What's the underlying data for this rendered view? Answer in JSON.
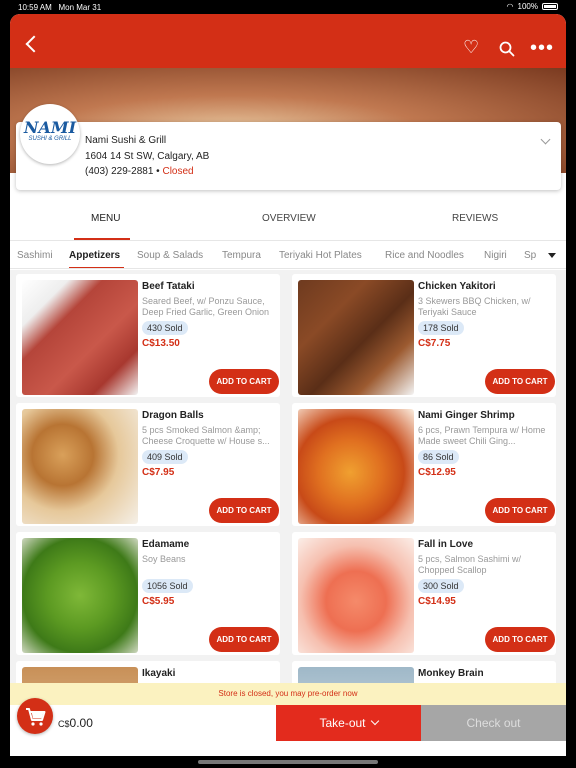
{
  "status_bar": {
    "time": "10:59 AM",
    "date": "Mon Mar 31",
    "battery": "100%"
  },
  "header": {
    "icons": [
      "back-icon",
      "heart-icon",
      "search-icon",
      "more-icon"
    ],
    "accent": "#d32f16"
  },
  "restaurant": {
    "logo_text": "NAMI",
    "logo_subtext": "SUSHI & GRILL",
    "name": "Nami Sushi & Grill",
    "address": "1604 14 St SW, Calgary, AB",
    "phone": "(403) 229-2881",
    "separator": "•",
    "status": "Closed"
  },
  "tabs": [
    {
      "label": "MENU",
      "active": true
    },
    {
      "label": "OVERVIEW"
    },
    {
      "label": "REVIEWS"
    }
  ],
  "categories": [
    {
      "label": "Sashimi"
    },
    {
      "label": "Appetizers",
      "active": true
    },
    {
      "label": "Soup & Salads"
    },
    {
      "label": "Tempura"
    },
    {
      "label": "Teriyaki Hot Plates"
    },
    {
      "label": "Rice and Noodles"
    },
    {
      "label": "Nigiri"
    },
    {
      "label": "Sp"
    }
  ],
  "items": [
    {
      "name": "Beef Tataki",
      "desc": "Seared Beef, w/ Ponzu Sauce, Deep Fried Garlic, Green Onion",
      "sold": "430 Sold",
      "currency": "C$",
      "price": "13.50",
      "cta": "ADD TO CART"
    },
    {
      "name": "Chicken Yakitori",
      "desc": "3 Skewers BBQ Chicken, w/ Teriyaki Sauce",
      "sold": "178 Sold",
      "currency": "C$",
      "price": "7.75",
      "cta": "ADD TO CART"
    },
    {
      "name": "Dragon Balls",
      "desc": "5 pcs Smoked Salmon &amp; Cheese Croquette w/ House s...",
      "sold": "409 Sold",
      "currency": "C$",
      "price": "7.95",
      "cta": "ADD TO CART"
    },
    {
      "name": "Nami Ginger Shrimp",
      "desc": "6 pcs, Prawn Tempura w/ Home Made sweet Chili Ging...",
      "sold": "86 Sold",
      "currency": "C$",
      "price": "12.95",
      "cta": "ADD TO CART"
    },
    {
      "name": "Edamame",
      "desc": "Soy Beans",
      "sold": "1056 Sold",
      "currency": "C$",
      "price": "5.95",
      "cta": "ADD TO CART"
    },
    {
      "name": "Fall in Love",
      "desc": "5 pcs, Salmon Sashimi w/ Chopped Scallop",
      "sold": "300 Sold",
      "currency": "C$",
      "price": "14.95",
      "cta": "ADD TO CART"
    },
    {
      "name": "Ikayaki",
      "desc": "",
      "sold": "",
      "currency": "",
      "price": "",
      "cta": ""
    },
    {
      "name": "Monkey Brain",
      "desc": "",
      "sold": "",
      "currency": "",
      "price": "",
      "cta": ""
    }
  ],
  "notice": "Store is closed, you may pre-order now",
  "bottom": {
    "currency": "C$",
    "total": "0.00",
    "order_type": "Take-out",
    "checkout": "Check out"
  }
}
